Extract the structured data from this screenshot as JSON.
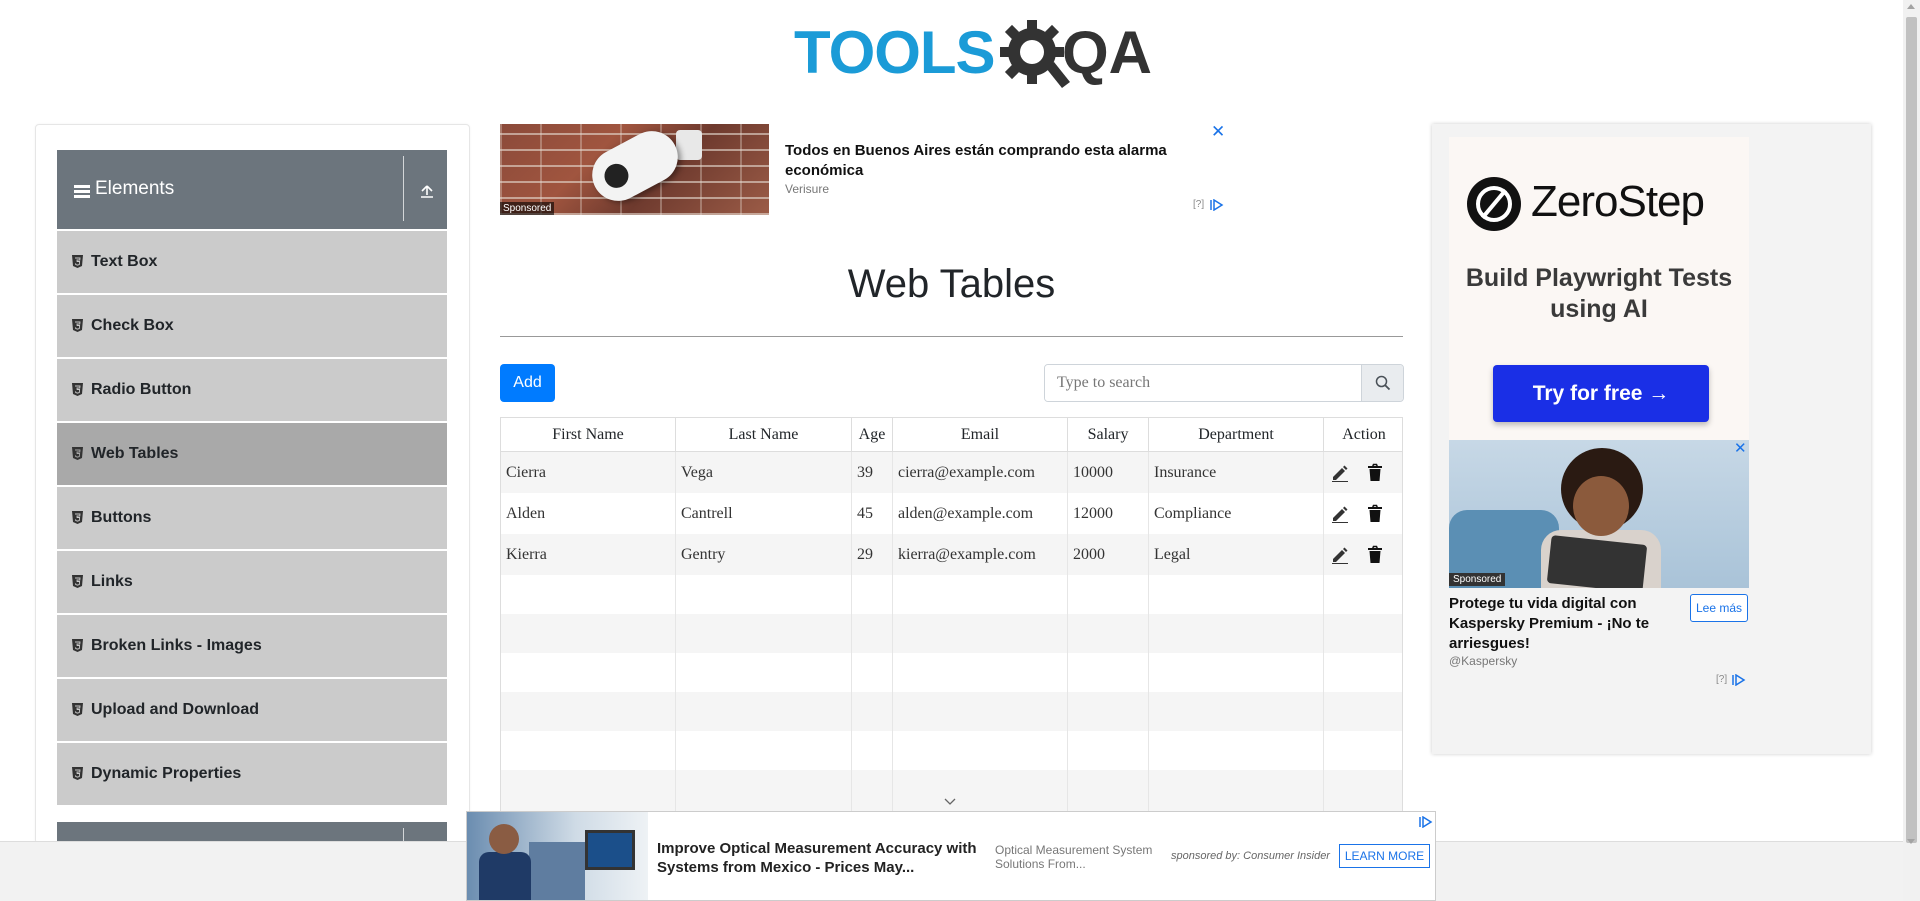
{
  "header": {
    "logo_text_primary": "TOOLS",
    "logo_text_secondary": "QA"
  },
  "sidebar": {
    "group_title": "Elements",
    "items": [
      {
        "label": "Text Box",
        "active": false
      },
      {
        "label": "Check Box",
        "active": false
      },
      {
        "label": "Radio Button",
        "active": false
      },
      {
        "label": "Web Tables",
        "active": true
      },
      {
        "label": "Buttons",
        "active": false
      },
      {
        "label": "Links",
        "active": false
      },
      {
        "label": "Broken Links - Images",
        "active": false
      },
      {
        "label": "Upload and Download",
        "active": false
      },
      {
        "label": "Dynamic Properties",
        "active": false
      }
    ]
  },
  "top_ad": {
    "title": "Todos en Buenos Aires están comprando esta alarma económica",
    "source": "Verisure",
    "sponsored": "Sponsored",
    "close": "✕",
    "help": "[?]"
  },
  "main": {
    "title": "Web Tables",
    "add_label": "Add",
    "search_placeholder": "Type to search"
  },
  "table": {
    "columns": [
      "First Name",
      "Last Name",
      "Age",
      "Email",
      "Salary",
      "Department",
      "Action"
    ],
    "rows": [
      [
        "Cierra",
        "Vega",
        "39",
        "cierra@example.com",
        "10000",
        "Insurance"
      ],
      [
        "Alden",
        "Cantrell",
        "45",
        "alden@example.com",
        "12000",
        "Compliance"
      ],
      [
        "Kierra",
        "Gentry",
        "29",
        "kierra@example.com",
        "2000",
        "Legal"
      ]
    ]
  },
  "right_ad": {
    "brand": "ZeroStep",
    "headline": "Build Playwright Tests using AI",
    "cta": "Try for free →",
    "kaspersky_title": "Protege tu vida digital con Kaspersky Premium - ¡No te arriesgues!",
    "kaspersky_source": "@Kaspersky",
    "kaspersky_button": "Lee más",
    "sponsored": "Sponsored",
    "close": "✕",
    "help": "[?]"
  },
  "bottom_ad": {
    "title": "Improve Optical Measurement Accuracy with Systems from Mexico - Prices May...",
    "desc": "Optical Measurement System Solutions From...",
    "sponsor": "sponsored by: Consumer Insider",
    "cta": "LEARN MORE"
  },
  "colors": {
    "primary": "#007bff",
    "logo_blue": "#1b9bd7",
    "sidebar_header": "#6c757d",
    "sidebar_item": "#cbcbcb",
    "sidebar_active": "#a9a9a9"
  }
}
